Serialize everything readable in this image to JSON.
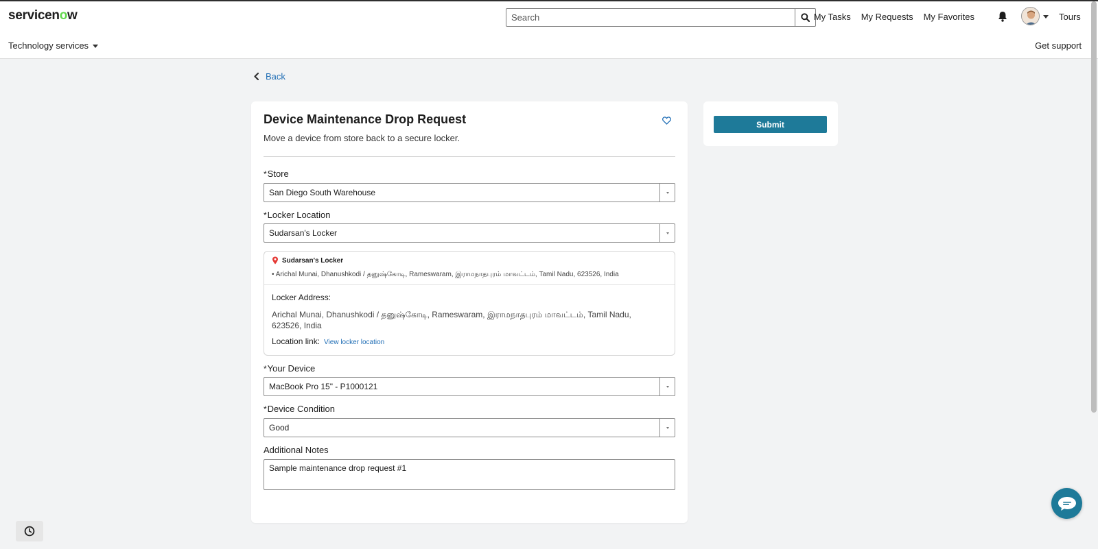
{
  "header": {
    "logo_main": "servicen",
    "logo_o": "o",
    "logo_end": "w",
    "search_placeholder": "Search",
    "nav": [
      "My Tasks",
      "My Requests",
      "My Favorites"
    ],
    "tours": "Tours",
    "portal_menu": "Technology services",
    "get_support": "Get support"
  },
  "back": "Back",
  "form": {
    "title": "Device Maintenance Drop Request",
    "subtitle": "Move a device from store back to a secure locker.",
    "required_mark": "*",
    "fields": {
      "store": {
        "label": "Store",
        "value": "San Diego South Warehouse"
      },
      "locker": {
        "label": "Locker Location",
        "value": "Sudarsan's Locker"
      },
      "device": {
        "label": "Your Device",
        "value": "MacBook Pro 15\" - P1000121"
      },
      "condition": {
        "label": "Device Condition",
        "value": "Good"
      },
      "notes": {
        "label": "Additional Notes",
        "value": "Sample maintenance drop request #1"
      }
    },
    "locker_info": {
      "name": "Sudarsan's Locker",
      "bullet_address": "• Arichal Munai, Dhanushkodi / தனுஷ்கோடி, Rameswaram, இராமநாதபுரம் மாவட்டம், Tamil Nadu, 623526, India",
      "address_label": "Locker Address:",
      "address": "Arichal Munai, Dhanushkodi / தனுஷ்கோடி, Rameswaram, இராமநாதபுரம் மாவட்டம், Tamil Nadu, 623526, India",
      "link_label": "Location link:",
      "link_text": "View locker location"
    }
  },
  "actions": {
    "submit": "Submit"
  },
  "colors": {
    "accent": "#1e7a99",
    "link": "#1f6db5",
    "logo_o": "#62d84e"
  }
}
